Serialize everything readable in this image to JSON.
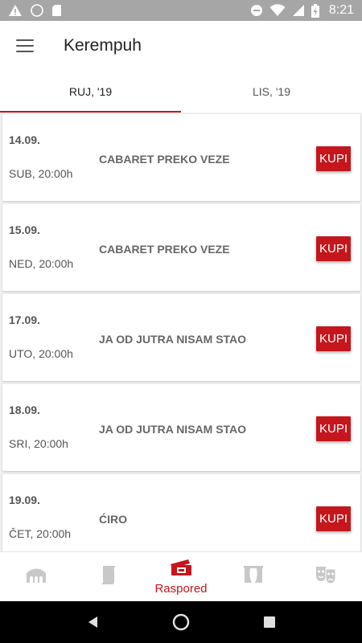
{
  "status_bar": {
    "time": "8:21",
    "icons": [
      "alert-icon",
      "circle-icon",
      "sd-card-icon",
      "dnd-icon",
      "wifi-icon",
      "cell-signal-icon",
      "battery-charging-icon"
    ]
  },
  "app_bar": {
    "title": "Kerempuh",
    "menu_icon": "hamburger-menu-icon"
  },
  "tabs": [
    {
      "label": "RUJ, '19",
      "active": true
    },
    {
      "label": "LIS, '19",
      "active": false
    }
  ],
  "events": [
    {
      "date": "14.09.",
      "time": "SUB, 20:00h",
      "title": "CABARET PREKO VEZE",
      "button": "KUPI"
    },
    {
      "date": "15.09.",
      "time": "NED, 20:00h",
      "title": "CABARET PREKO VEZE",
      "button": "KUPI"
    },
    {
      "date": "17.09.",
      "time": "UTO, 20:00h",
      "title": "JA OD JUTRA NISAM STAO",
      "button": "KUPI"
    },
    {
      "date": "18.09.",
      "time": "SRI, 20:00h",
      "title": "JA OD JUTRA NISAM STAO",
      "button": "KUPI"
    },
    {
      "date": "19.09.",
      "time": "ČET, 20:00h",
      "title": "ĆIRO",
      "button": "KUPI"
    }
  ],
  "bottom_nav": {
    "items": [
      {
        "icon": "theater-building-icon",
        "label": ""
      },
      {
        "icon": "scroll-icon",
        "label": ""
      },
      {
        "icon": "ticket-icon",
        "label": "Raspored",
        "active": true
      },
      {
        "icon": "stage-curtain-icon",
        "label": ""
      },
      {
        "icon": "theater-masks-icon",
        "label": ""
      }
    ]
  },
  "colors": {
    "accent": "#c4161c",
    "status_bar": "#a6a6a6",
    "inactive_icon": "#c8c8c8"
  }
}
